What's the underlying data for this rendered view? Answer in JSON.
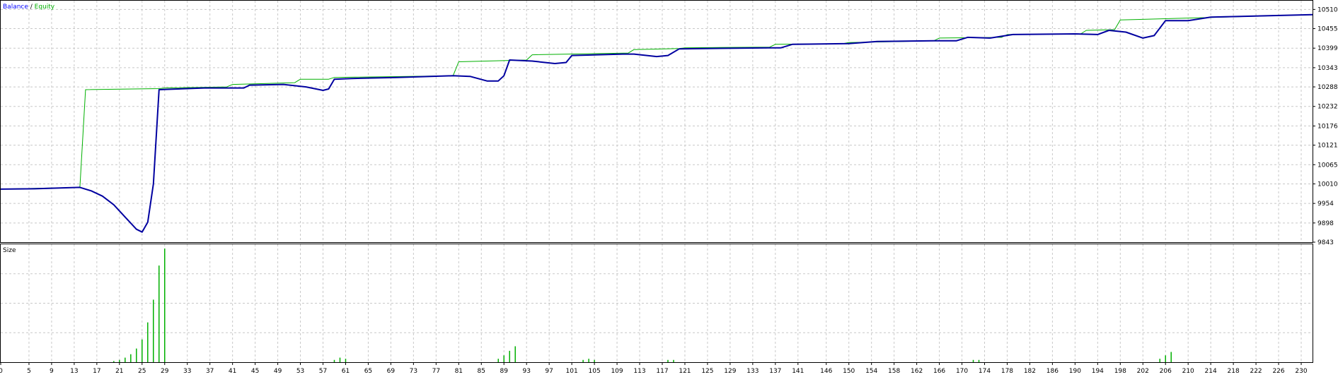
{
  "legend": {
    "balance": "Balance",
    "separator": " / ",
    "equity": "Equity",
    "size": "Size"
  },
  "chart_data": {
    "type": "line",
    "title": "",
    "xlabel": "",
    "ylabel": "",
    "xlim": [
      0,
      232
    ],
    "ylim": [
      9843,
      10535
    ],
    "x_ticks": [
      0,
      5,
      9,
      13,
      17,
      21,
      25,
      29,
      33,
      37,
      41,
      45,
      49,
      53,
      57,
      61,
      65,
      69,
      73,
      77,
      81,
      85,
      89,
      93,
      97,
      101,
      105,
      109,
      113,
      117,
      121,
      125,
      129,
      133,
      137,
      141,
      146,
      150,
      154,
      158,
      162,
      166,
      170,
      174,
      178,
      182,
      186,
      190,
      194,
      198,
      202,
      206,
      210,
      214,
      218,
      222,
      226,
      230
    ],
    "y_ticks": [
      10510,
      10455,
      10399,
      10343,
      10288,
      10232,
      10176,
      10121,
      10065,
      10010,
      9954,
      9898,
      9843
    ],
    "grid": true,
    "series": [
      {
        "name": "Balance",
        "color": "#00b000",
        "points": [
          [
            0,
            9995
          ],
          [
            14,
            10000
          ],
          [
            15,
            10280
          ],
          [
            28,
            10283
          ],
          [
            29,
            10285
          ],
          [
            40,
            10288
          ],
          [
            41,
            10295
          ],
          [
            52,
            10300
          ],
          [
            53,
            10310
          ],
          [
            58,
            10310
          ],
          [
            59,
            10315
          ],
          [
            80,
            10320
          ],
          [
            81,
            10360
          ],
          [
            93,
            10365
          ],
          [
            94,
            10380
          ],
          [
            111,
            10385
          ],
          [
            112,
            10395
          ],
          [
            120,
            10398
          ],
          [
            121,
            10400
          ],
          [
            136,
            10402
          ],
          [
            137,
            10410
          ],
          [
            149,
            10412
          ],
          [
            150,
            10415
          ],
          [
            165,
            10420
          ],
          [
            166,
            10428
          ],
          [
            177,
            10430
          ],
          [
            178,
            10438
          ],
          [
            191,
            10440
          ],
          [
            192,
            10450
          ],
          [
            197,
            10452
          ],
          [
            198,
            10480
          ],
          [
            232,
            10495
          ]
        ]
      },
      {
        "name": "Equity",
        "color": "#0000a0",
        "points": [
          [
            0,
            9995
          ],
          [
            6,
            9996
          ],
          [
            10,
            9998
          ],
          [
            14,
            10000
          ],
          [
            16,
            9990
          ],
          [
            18,
            9975
          ],
          [
            20,
            9950
          ],
          [
            22,
            9915
          ],
          [
            24,
            9880
          ],
          [
            25,
            9872
          ],
          [
            26,
            9900
          ],
          [
            27,
            10010
          ],
          [
            28,
            10280
          ],
          [
            36,
            10285
          ],
          [
            43,
            10285
          ],
          [
            44,
            10293
          ],
          [
            50,
            10295
          ],
          [
            54,
            10288
          ],
          [
            57,
            10278
          ],
          [
            58,
            10282
          ],
          [
            59,
            10310
          ],
          [
            62,
            10312
          ],
          [
            70,
            10315
          ],
          [
            80,
            10320
          ],
          [
            83,
            10318
          ],
          [
            86,
            10305
          ],
          [
            88,
            10305
          ],
          [
            89,
            10320
          ],
          [
            90,
            10365
          ],
          [
            94,
            10362
          ],
          [
            98,
            10355
          ],
          [
            100,
            10358
          ],
          [
            101,
            10378
          ],
          [
            110,
            10382
          ],
          [
            112,
            10382
          ],
          [
            116,
            10375
          ],
          [
            118,
            10378
          ],
          [
            120,
            10397
          ],
          [
            136,
            10400
          ],
          [
            138,
            10400
          ],
          [
            140,
            10410
          ],
          [
            150,
            10412
          ],
          [
            155,
            10418
          ],
          [
            165,
            10420
          ],
          [
            169,
            10420
          ],
          [
            171,
            10430
          ],
          [
            175,
            10428
          ],
          [
            179,
            10438
          ],
          [
            190,
            10440
          ],
          [
            194,
            10438
          ],
          [
            196,
            10450
          ],
          [
            199,
            10445
          ],
          [
            202,
            10428
          ],
          [
            204,
            10435
          ],
          [
            206,
            10478
          ],
          [
            210,
            10478
          ],
          [
            214,
            10488
          ],
          [
            232,
            10495
          ]
        ]
      }
    ],
    "size_panel": {
      "name": "Size",
      "bars": [
        [
          20,
          0.01
        ],
        [
          21,
          0.02
        ],
        [
          22,
          0.04
        ],
        [
          23,
          0.07
        ],
        [
          24,
          0.12
        ],
        [
          25,
          0.2
        ],
        [
          26,
          0.35
        ],
        [
          27,
          0.55
        ],
        [
          28,
          0.85
        ],
        [
          29,
          1.0
        ],
        [
          59,
          0.02
        ],
        [
          60,
          0.04
        ],
        [
          61,
          0.03
        ],
        [
          88,
          0.03
        ],
        [
          89,
          0.06
        ],
        [
          90,
          0.1
        ],
        [
          91,
          0.14
        ],
        [
          103,
          0.02
        ],
        [
          104,
          0.03
        ],
        [
          105,
          0.02
        ],
        [
          118,
          0.02
        ],
        [
          119,
          0.02
        ],
        [
          172,
          0.02
        ],
        [
          173,
          0.02
        ],
        [
          205,
          0.03
        ],
        [
          206,
          0.06
        ],
        [
          207,
          0.09
        ]
      ]
    }
  }
}
